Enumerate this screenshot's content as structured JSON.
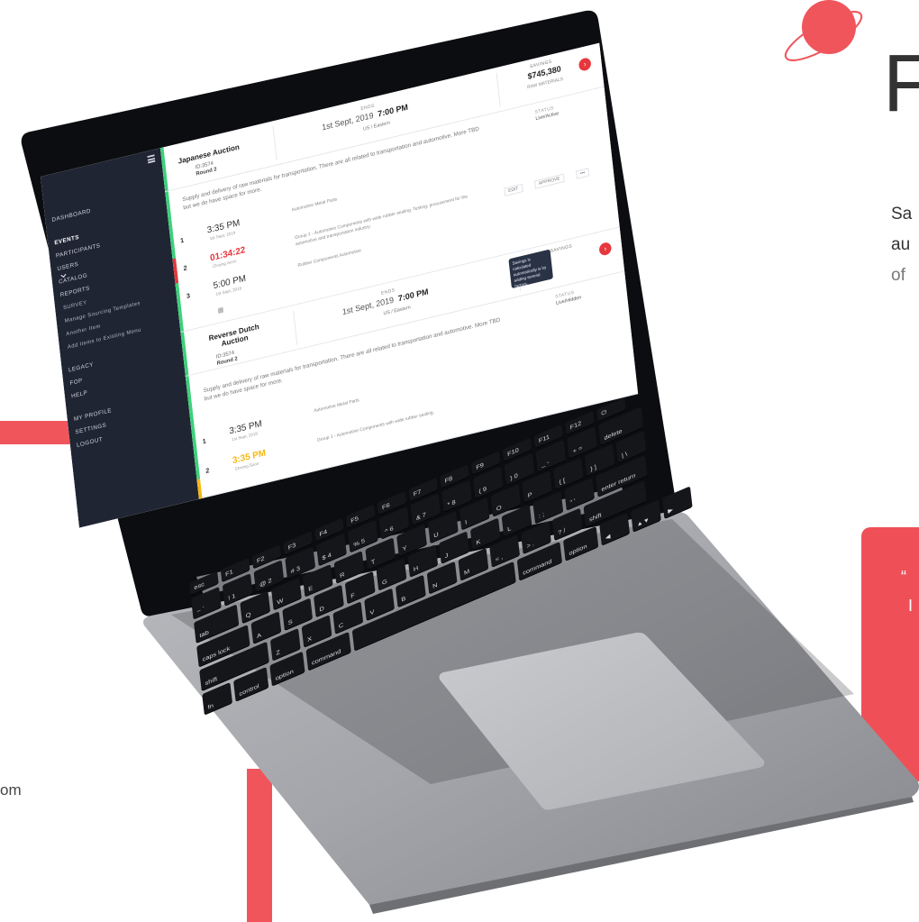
{
  "page": {
    "heading_fragment": "F",
    "intro_lines": [
      "Sa",
      "au",
      "of"
    ],
    "quote_lines": [
      "“",
      "I"
    ],
    "contact_fragment": "om",
    "colors": {
      "accent": "#f0555c",
      "sidebar": "#1f2533",
      "green": "#3dd07a",
      "red": "#e7373d",
      "amber": "#f4b814"
    }
  },
  "app": {
    "nav": {
      "items": [
        "DASHBOARD",
        "EVENTS",
        "PARTICIPANTS",
        "USERS",
        "CATALOG",
        "REPORTS"
      ],
      "sub_items": [
        "SURVEY",
        "Manage Sourcing Templates",
        "Another Item",
        "Add Items to Existing Menu"
      ],
      "lower_items": [
        "LEGACY",
        "FOP",
        "HELP"
      ],
      "account_items": [
        "MY PROFILE",
        "SETTINGS",
        "LOGOUT"
      ]
    },
    "events": [
      {
        "title": "Japanese Auction",
        "id": "ID:3574",
        "round": "Round 2",
        "ends_label": "ENDS",
        "ends_date": "1st Sept, 2019",
        "ends_time": "7:00 PM",
        "timezone": "US / Eastern",
        "savings_label": "SAVINGS",
        "savings_value": "$745,380",
        "savings_sub": "RAW MATERIALS",
        "status_label": "STATUS",
        "status_value": "Live/Active",
        "description": "Supply and delivery of raw materials for transportation. There are all related to transportation and automotive. More TBD but we do have space for more.",
        "rounds": [
          {
            "num": "1",
            "time": "3:35 PM",
            "sub": "1st Sept, 2019",
            "info": "Automotive Metal Parts"
          },
          {
            "num": "2",
            "time": "01:34:22",
            "sub": "Closing Soon",
            "info": "Group 1 - Automotive Components with wide rubber sealing. Testing; procurement for the automotive and transportation industry.",
            "actions": [
              "EDIT",
              "APPROVE",
              "•••"
            ]
          },
          {
            "num": "3",
            "time": "5:00 PM",
            "sub": "1st Sept, 2019",
            "info": "Rubber Components Automotive"
          }
        ]
      },
      {
        "title": "Reverse Dutch Auction",
        "id": "ID:3574",
        "round": "Round 2",
        "ends_label": "ENDS",
        "ends_date": "1st Sept, 2019",
        "ends_time": "7:00 PM",
        "timezone": "US / Eastern",
        "savings_label": "SAVINGS",
        "tooltip": "Savings is calculated automatically is by adding several factors.",
        "status_label": "STATUS",
        "status_value": "Live/Hidden",
        "description": "Supply and delivery of raw materials for transportation. There are all related to transportation and automotive. More TBD but we do have space for more.",
        "rounds": [
          {
            "num": "1",
            "time": "3:35 PM",
            "sub": "1st Sept, 2019",
            "info": "Automotive Metal Parts"
          },
          {
            "num": "2",
            "time": "3:35 PM",
            "sub": "Closing Soon",
            "info": "Group 1 - Automotive Components with wide rubber sealing."
          }
        ]
      }
    ]
  },
  "keyboard": {
    "fn_row": [
      "esc",
      "F1",
      "F2",
      "F3",
      "F4",
      "F5",
      "F6",
      "F7",
      "F8",
      "F9",
      "F10",
      "F11",
      "F12",
      "⏻"
    ],
    "num_row": [
      "~ `",
      "! 1",
      "@ 2",
      "# 3",
      "$ 4",
      "% 5",
      "^ 6",
      "& 7",
      "* 8",
      "( 9",
      ") 0",
      "_ -",
      "+ =",
      "delete"
    ],
    "q_row": [
      "tab",
      "Q",
      "W",
      "E",
      "R",
      "T",
      "Y",
      "U",
      "I",
      "O",
      "P",
      "{ [",
      "} ]",
      "| \\"
    ],
    "a_row": [
      "caps lock",
      "A",
      "S",
      "D",
      "F",
      "G",
      "H",
      "J",
      "K",
      "L",
      ": ;",
      "\" '",
      "enter return"
    ],
    "z_row": [
      "shift",
      "Z",
      "X",
      "C",
      "V",
      "B",
      "N",
      "M",
      "< ,",
      "> .",
      "? /",
      "shift"
    ],
    "bottom_row": [
      "fn",
      "control",
      "option",
      "command",
      "",
      "command",
      "option",
      "◀",
      "▲▼",
      "▶"
    ]
  }
}
